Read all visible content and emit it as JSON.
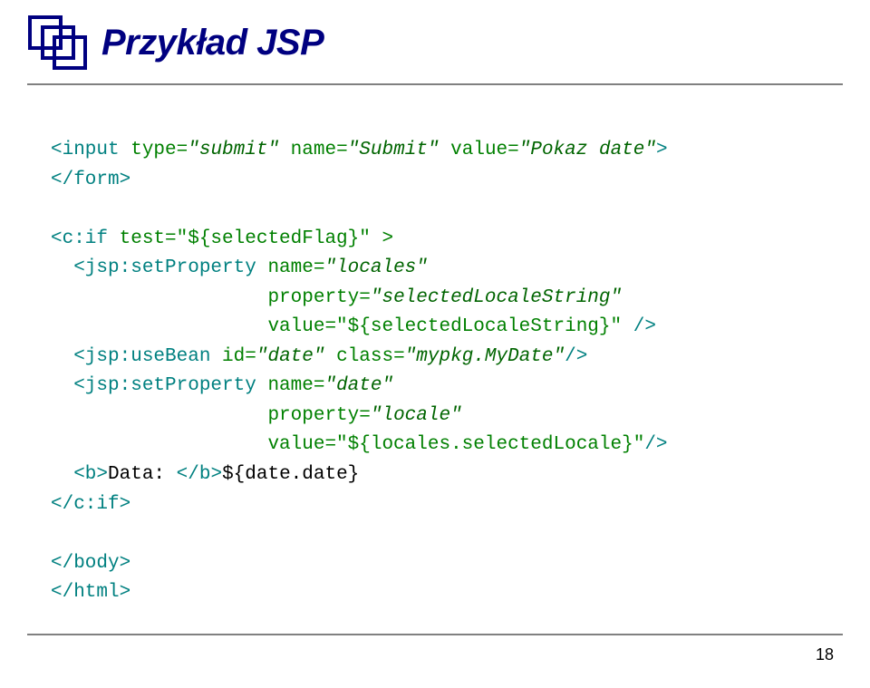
{
  "title": "Przykład JSP",
  "page_number": "18",
  "code": {
    "l1a": "<input",
    "l1b": " type=",
    "l1c": "\"submit\"",
    "l1d": " name=",
    "l1e": "\"Submit\"",
    "l1f": " value=",
    "l1g": "\"Pokaz date\"",
    "l1h": ">",
    "l2": "</form>",
    "l3": "",
    "l4a": "<c:if",
    "l4b": " test=\"${selectedFlag}\" >",
    "l5a": "  <jsp:setProperty",
    "l5b": " name=",
    "l5c": "\"locales\"",
    "l6a": "                   property=",
    "l6b": "\"selectedLocaleString\"",
    "l7a": "                   value=\"${selectedLocaleString}\" ",
    "l7b": "/>",
    "l8a": "  <jsp:useBean",
    "l8b": " id=",
    "l8c": "\"date\"",
    "l8d": " class=",
    "l8e": "\"mypkg.MyDate\"",
    "l8f": "/>",
    "l9a": "  <jsp:setProperty",
    "l9b": " name=",
    "l9c": "\"date\"",
    "l10a": "                   property=",
    "l10b": "\"locale\"",
    "l11a": "                   value=\"${locales.selectedLocale}\"",
    "l11b": "/>",
    "l12a": "  <b>",
    "l12b": "Data: ",
    "l12c": "</b>",
    "l12d": "${date.date}",
    "l13": "</c:if>",
    "l14": "",
    "l15": "</body>",
    "l16": "</html>"
  }
}
